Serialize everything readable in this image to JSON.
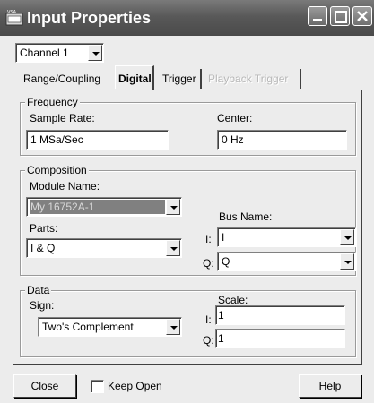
{
  "window": {
    "title": "Input Properties",
    "icon": "vsa-app-icon"
  },
  "channel": {
    "selected": "Channel 1"
  },
  "tabs": [
    {
      "label": "Range/Coupling",
      "state": "normal"
    },
    {
      "label": "Digital",
      "state": "active"
    },
    {
      "label": "Trigger",
      "state": "normal"
    },
    {
      "label": "Playback Trigger",
      "state": "disabled"
    }
  ],
  "frequency": {
    "group_label": "Frequency",
    "sample_rate_label": "Sample Rate:",
    "sample_rate_value": "1 MSa/Sec",
    "center_label": "Center:",
    "center_value": "0 Hz"
  },
  "composition": {
    "group_label": "Composition",
    "module_name_label": "Module Name:",
    "module_name_value": "My 16752A-1",
    "parts_label": "Parts:",
    "parts_value": "I & Q",
    "bus_name_label": "Bus Name:",
    "i_label": "I:",
    "i_value": "I",
    "q_label": "Q:",
    "q_value": "Q"
  },
  "data": {
    "group_label": "Data",
    "sign_label": "Sign:",
    "sign_value": "Two's Complement",
    "scale_label": "Scale:",
    "i_label": "I:",
    "i_scale": "1",
    "q_label": "Q:",
    "q_scale": "1"
  },
  "footer": {
    "close_label": "Close",
    "keep_open_label": "Keep Open",
    "keep_open_checked": false,
    "help_label": "Help"
  }
}
